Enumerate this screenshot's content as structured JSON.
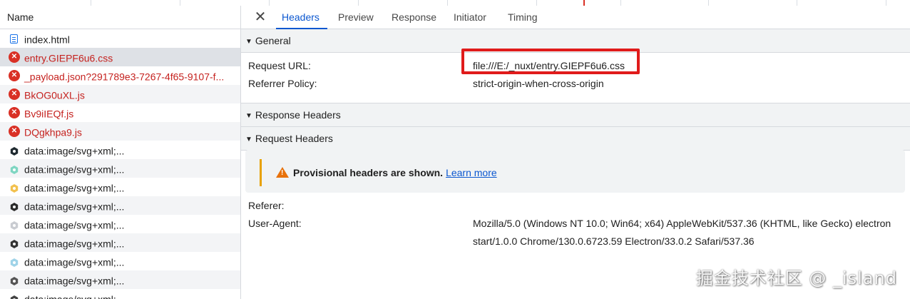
{
  "left_panel": {
    "header": "Name",
    "rows": [
      {
        "name": "index.html",
        "type": "doc"
      },
      {
        "name": "entry.GIEPF6u6.css",
        "type": "error"
      },
      {
        "name": "_payload.json?291789e3-7267-4f65-9107-f...",
        "type": "error"
      },
      {
        "name": "BkOG0uXL.js",
        "type": "error"
      },
      {
        "name": "Bv9iIEQf.js",
        "type": "error"
      },
      {
        "name": "DQgkhpa9.js",
        "type": "error"
      },
      {
        "name": "data:image/svg+xml;...",
        "type": "svg",
        "color": "#1f2a30"
      },
      {
        "name": "data:image/svg+xml;...",
        "type": "svg",
        "color": "#7fd6c2"
      },
      {
        "name": "data:image/svg+xml;...",
        "type": "svg",
        "color": "#f2c14e"
      },
      {
        "name": "data:image/svg+xml;...",
        "type": "svg",
        "color": "#2b2b2b"
      },
      {
        "name": "data:image/svg+xml;...",
        "type": "svg",
        "color": "#c9ccd1"
      },
      {
        "name": "data:image/svg+xml;...",
        "type": "svg",
        "color": "#333333"
      },
      {
        "name": "data:image/svg+xml;...",
        "type": "svg",
        "color": "#9fd3e8"
      },
      {
        "name": "data:image/svg+xml;...",
        "type": "svg",
        "color": "#555555"
      },
      {
        "name": "data:image/svg+xml;...",
        "type": "svg",
        "color": "#444444"
      }
    ]
  },
  "tabs": {
    "close_icon": "close-icon",
    "items": [
      "Headers",
      "Preview",
      "Response",
      "Initiator",
      "Timing"
    ],
    "active": "Headers"
  },
  "general": {
    "title": "General",
    "request_url_label": "Request URL:",
    "request_url_value": "file:///E:/_nuxt/entry.GIEPF6u6.css",
    "referrer_policy_label": "Referrer Policy:",
    "referrer_policy_value": "strict-origin-when-cross-origin"
  },
  "response_headers": {
    "title": "Response Headers"
  },
  "request_headers": {
    "title": "Request Headers",
    "warning_text": "Provisional headers are shown.",
    "learn_more": "Learn more",
    "referer_label": "Referer:",
    "user_agent_label": "User-Agent:",
    "user_agent_line1": "Mozilla/5.0 (Windows NT 10.0; Win64; x64) AppleWebKit/537.36 (KHTML, like Gecko) electron",
    "user_agent_line2": "start/1.0.0 Chrome/130.0.6723.59 Electron/33.0.2 Safari/537.36"
  },
  "watermark": "掘金技术社区 @ _island",
  "colors": {
    "accent": "#0b57d0",
    "error": "#d93025",
    "highlight_box": "#e01b1b",
    "warning": "#e8710a"
  }
}
